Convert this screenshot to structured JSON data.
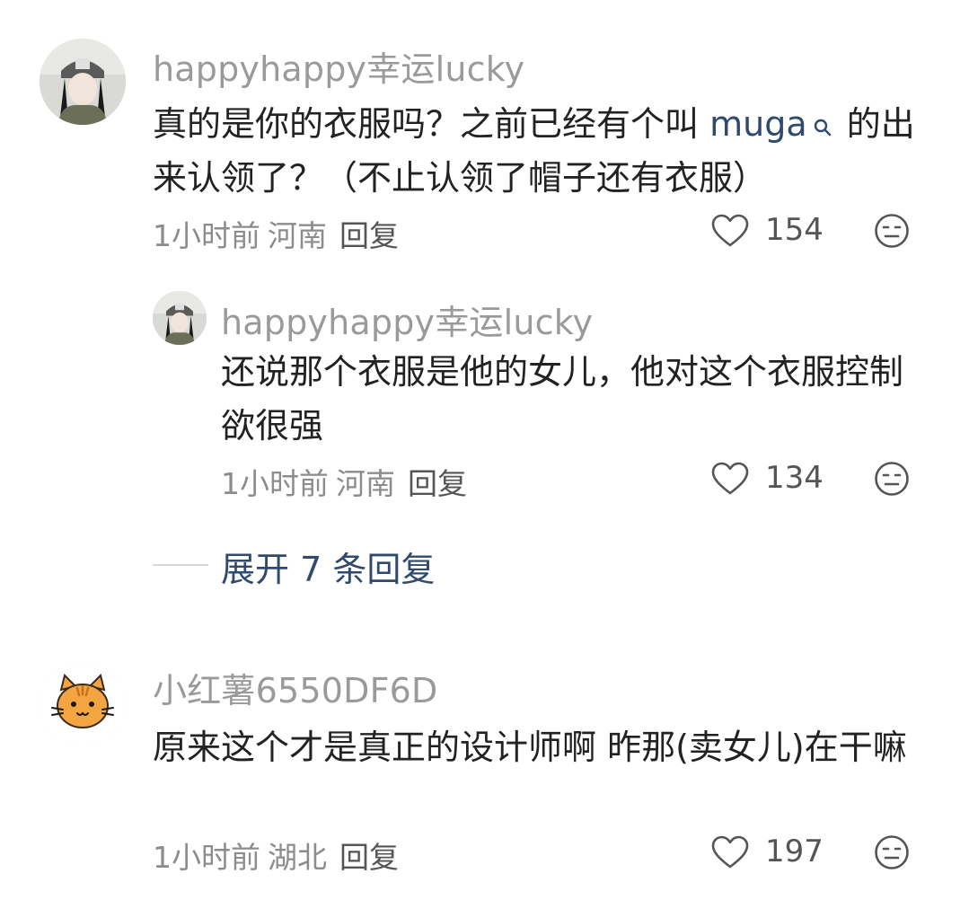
{
  "comments": [
    {
      "username": "happyhappy幸运lucky",
      "text_before": "真的是你的衣服吗？之前已经有个叫 ",
      "mention": "muga",
      "text_after": " 的出来认领了？（不止认领了帽子还有衣服）",
      "time": "1小时前",
      "region": "河南",
      "reply_label": "回复",
      "likes": "154"
    },
    {
      "username": "happyhappy幸运lucky",
      "text": "还说那个衣服是他的女儿，他对这个衣服控制欲很强",
      "time": "1小时前",
      "region": "河南",
      "reply_label": "回复",
      "likes": "134"
    },
    {
      "username": "小红薯6550DF6D",
      "text": "原来这个才是真正的设计师啊 昨那(卖女儿)在干嘛",
      "time": "1小时前",
      "region": "湖北",
      "reply_label": "回复",
      "likes": "197"
    }
  ],
  "expand_replies_label": "展开 7 条回复",
  "icons": {
    "like": "heart-outline-icon",
    "dislike": "meh-face-icon",
    "mention_search": "search-icon"
  },
  "colors": {
    "username": "#9a9a9a",
    "body": "#222222",
    "link": "#2f4a6e",
    "meta": "#8c8c8c"
  }
}
